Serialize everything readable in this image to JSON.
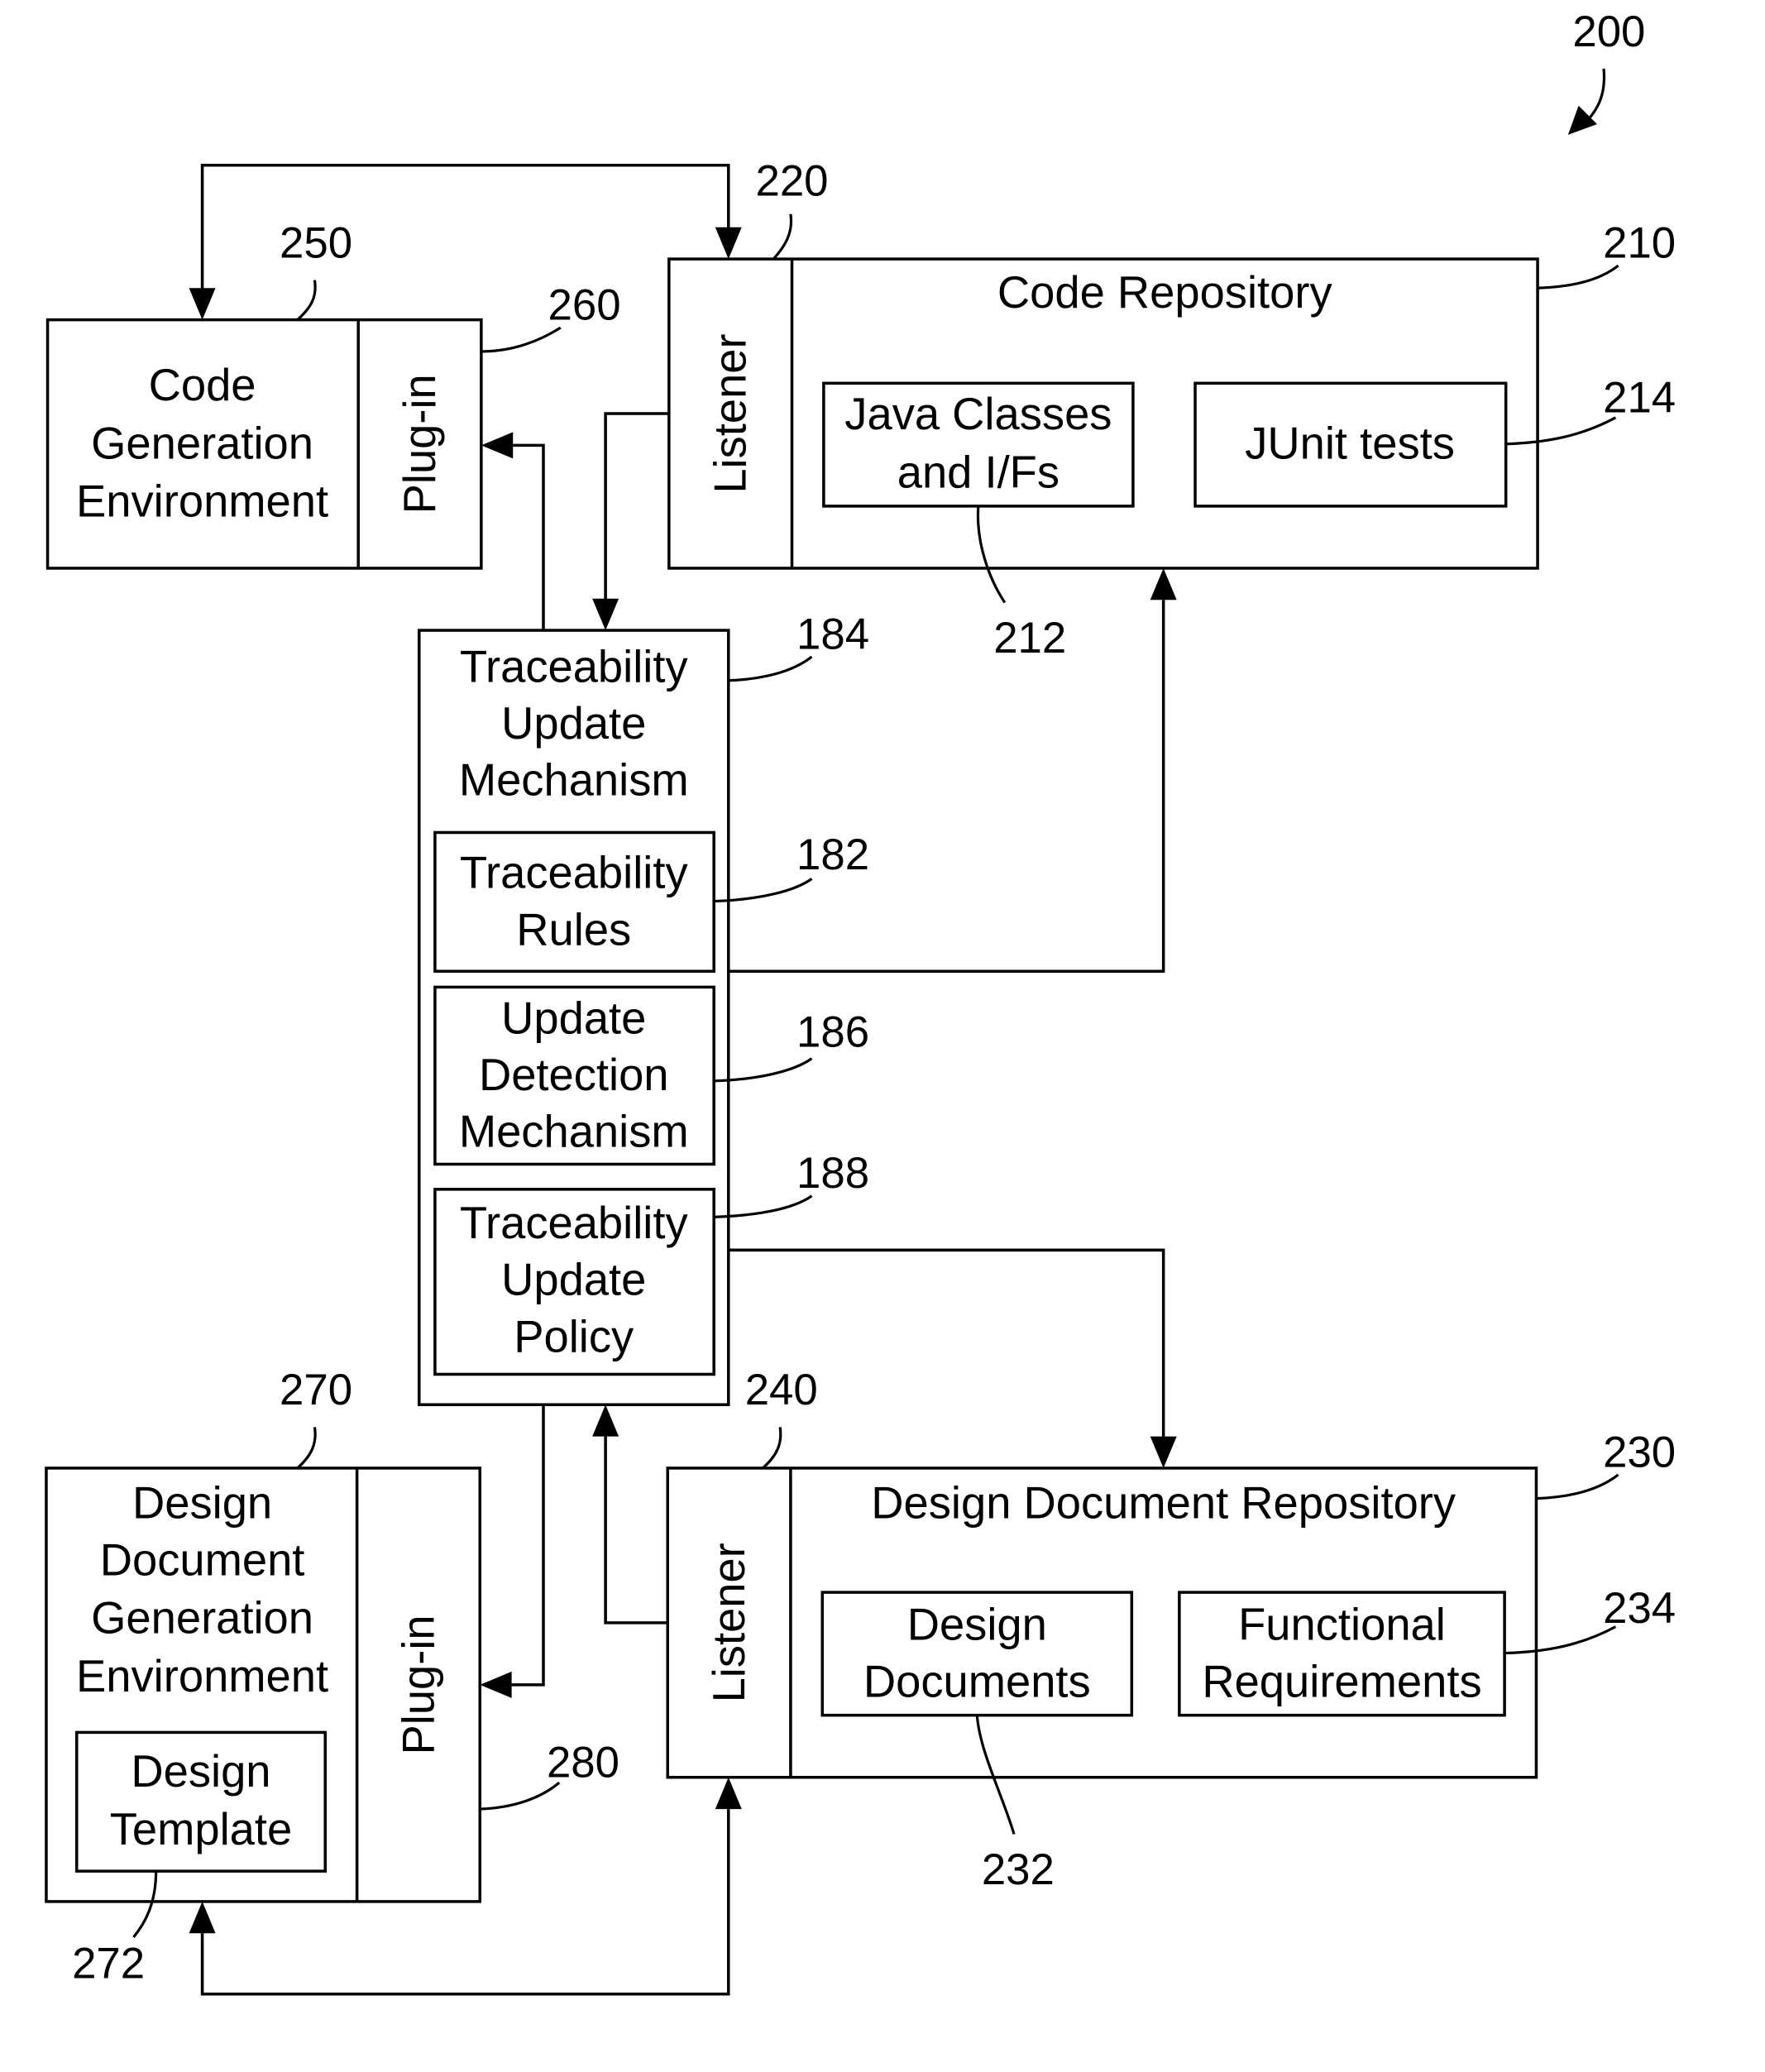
{
  "figure_ref": "200",
  "code_generation_env": {
    "ref": "250",
    "lines": [
      "Code",
      "Generation",
      "Environment"
    ],
    "plugin": {
      "ref": "260",
      "label": "Plug-in"
    }
  },
  "code_repository": {
    "ref": "210",
    "title": "Code Repository",
    "listener": {
      "ref": "220",
      "label": "Listener"
    },
    "items": [
      {
        "ref": "212",
        "lines": [
          "Java Classes",
          "and I/Fs"
        ]
      },
      {
        "ref": "214",
        "lines": [
          "JUnit tests"
        ]
      }
    ]
  },
  "traceability_update_mechanism": {
    "ref": "184",
    "lines": [
      "Traceability",
      "Update",
      "Mechanism"
    ],
    "components": [
      {
        "ref": "182",
        "lines": [
          "Traceability",
          "Rules"
        ]
      },
      {
        "ref": "186",
        "lines": [
          "Update",
          "Detection",
          "Mechanism"
        ]
      },
      {
        "ref": "188",
        "lines": [
          "Traceability",
          "Update",
          "Policy"
        ]
      }
    ]
  },
  "design_doc_generation_env": {
    "ref": "270",
    "lines": [
      "Design",
      "Document",
      "Generation",
      "Environment"
    ],
    "template": {
      "ref": "272",
      "lines": [
        "Design",
        "Template"
      ]
    },
    "plugin": {
      "ref": "280",
      "label": "Plug-in"
    }
  },
  "design_document_repository": {
    "ref": "230",
    "title": "Design Document Repository",
    "listener": {
      "ref": "240",
      "label": "Listener"
    },
    "items": [
      {
        "ref": "232",
        "lines": [
          "Design",
          "Documents"
        ]
      },
      {
        "ref": "234",
        "lines": [
          "Functional",
          "Requirements"
        ]
      }
    ]
  }
}
